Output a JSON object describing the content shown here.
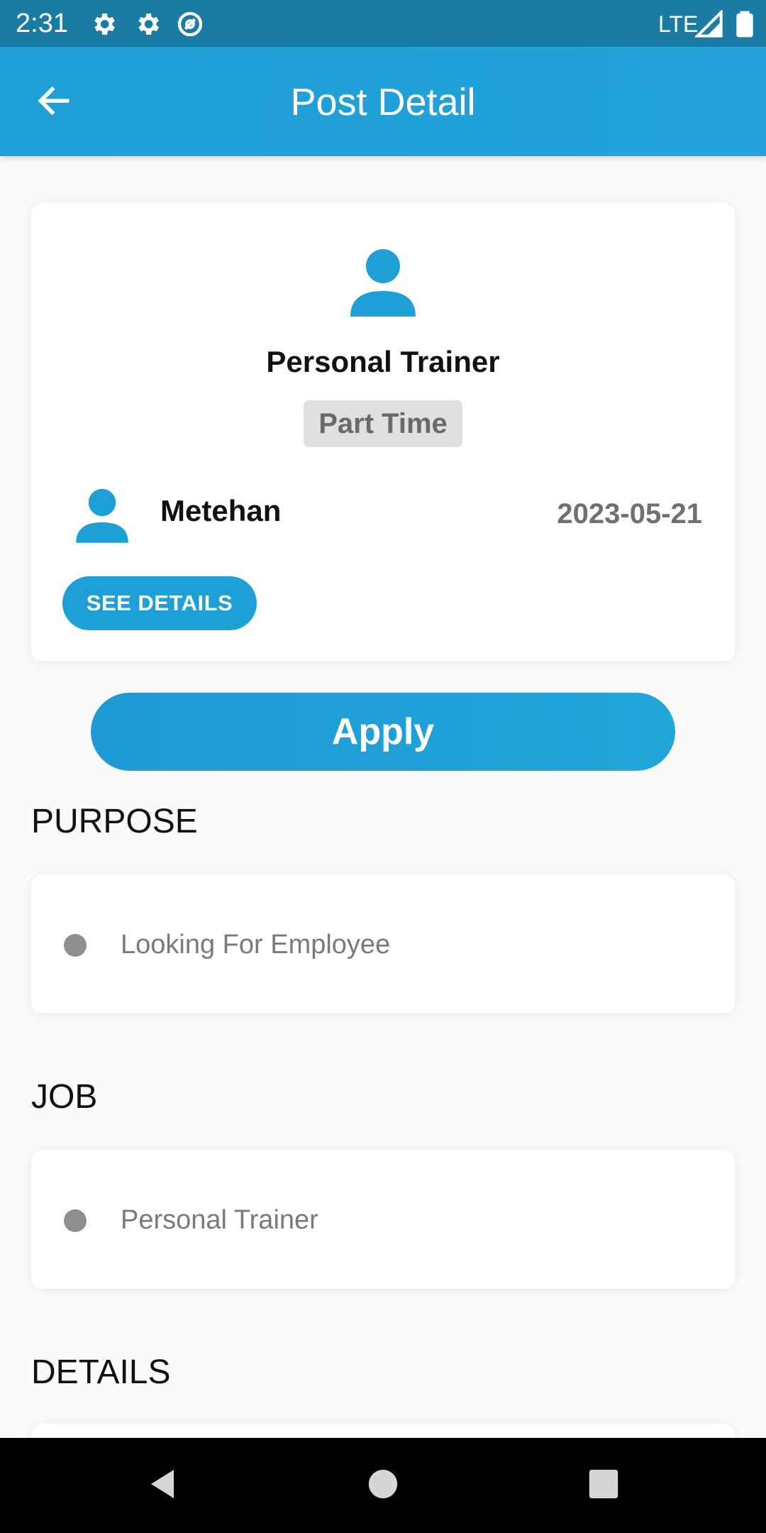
{
  "status_bar": {
    "time": "2:31",
    "network": "LTE",
    "icons": [
      "settings-icon",
      "settings-icon",
      "at-sign-icon",
      "signal-icon",
      "battery-icon"
    ]
  },
  "app_bar": {
    "title": "Post Detail",
    "back_icon": "arrow-left-icon"
  },
  "post": {
    "title": "Personal Trainer",
    "type": "Part Time",
    "author": "Metehan",
    "date": "2023-05-21",
    "see_details_label": "SEE DETAILS"
  },
  "apply_label": "Apply",
  "sections": {
    "purpose": {
      "heading": "PURPOSE",
      "value": "Looking For Employee"
    },
    "job": {
      "heading": "JOB",
      "value": "Personal Trainer"
    },
    "details": {
      "heading": "DETAILS"
    }
  },
  "nav_bar": {
    "buttons": [
      "back-triangle-icon",
      "home-circle-icon",
      "recents-square-icon"
    ]
  },
  "colors": {
    "status_bar": "#1a7ba3",
    "primary": "#1e9fd6",
    "background": "#fafafa",
    "badge": "#e0e0e0"
  }
}
